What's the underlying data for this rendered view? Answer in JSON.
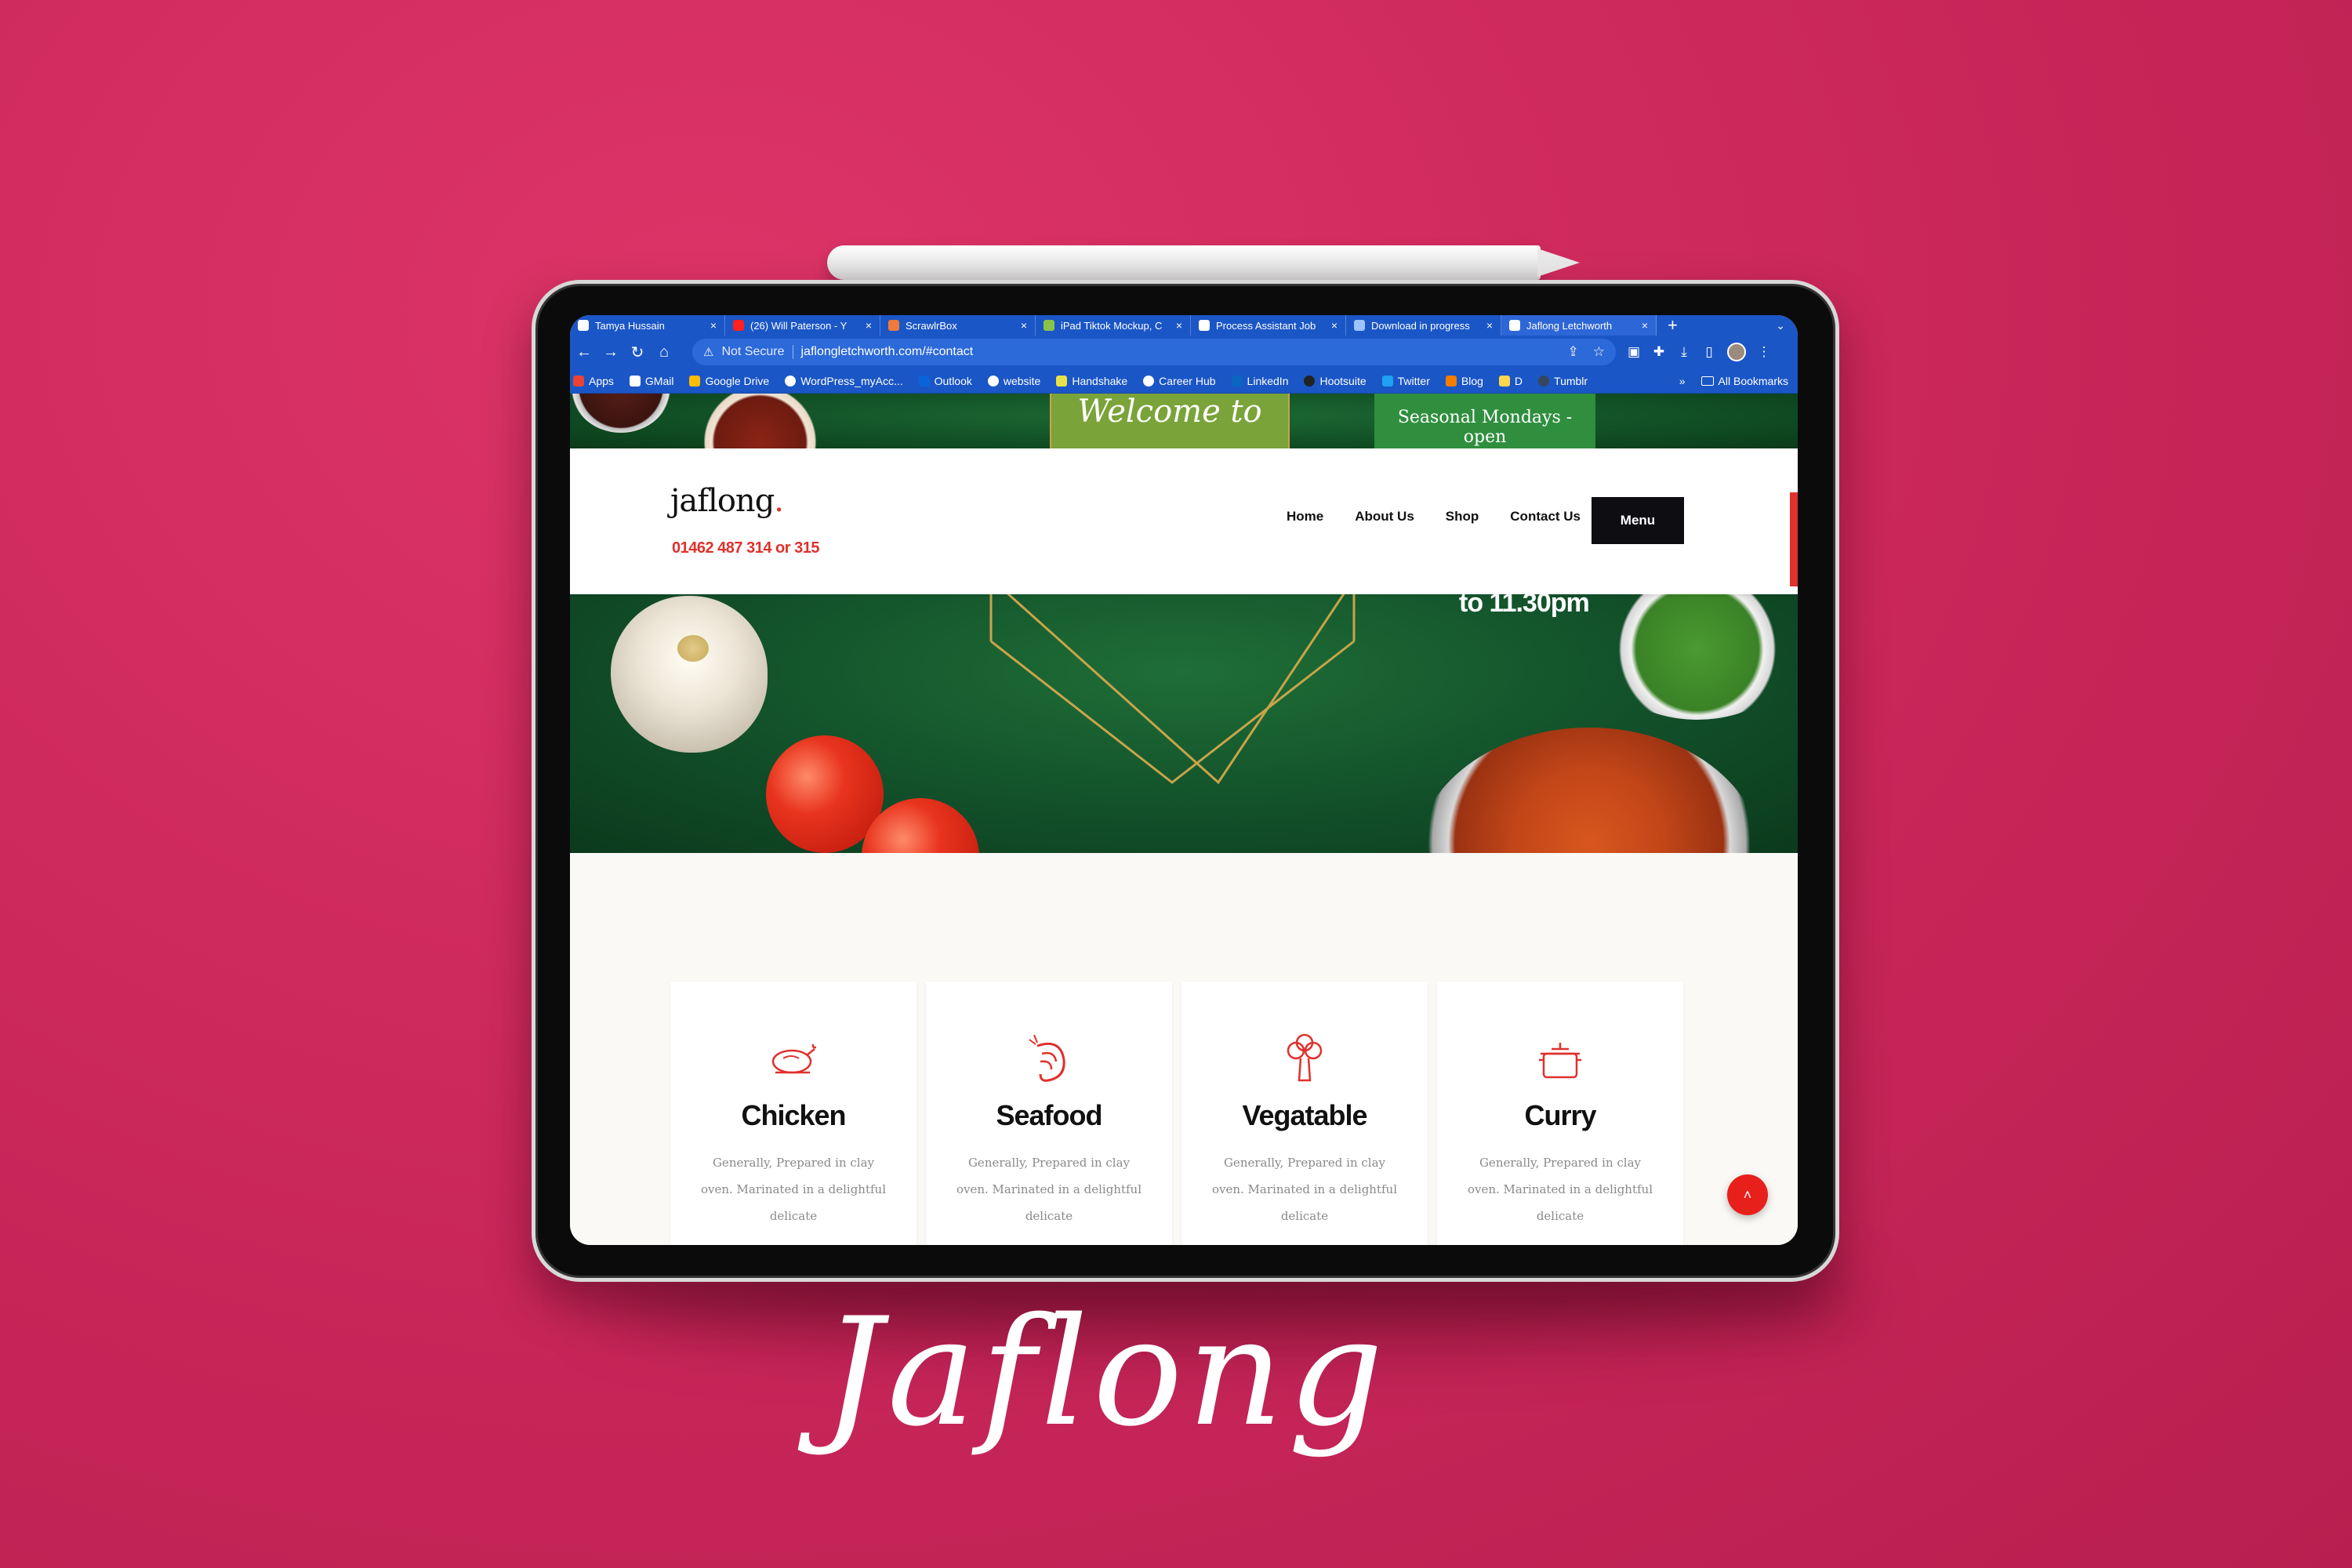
{
  "browser": {
    "tabs": [
      {
        "title": "Tamya Hussain",
        "active": false
      },
      {
        "title": "(26) Will Paterson - Y",
        "active": false
      },
      {
        "title": "ScrawlrBox",
        "active": false
      },
      {
        "title": "iPad Tiktok Mockup, C",
        "active": false
      },
      {
        "title": "Process Assistant Job",
        "active": false
      },
      {
        "title": "Download in progress",
        "active": false
      },
      {
        "title": "Jaflong Letchworth",
        "active": true
      }
    ],
    "new_tab": "+",
    "security_label": "Not Secure",
    "url": "jaflongletchworth.com/#contact",
    "bookmarks": [
      "Apps",
      "GMail",
      "Google Drive",
      "WordPress_myAcc...",
      "Outlook",
      "website",
      "Handshake",
      "Career Hub",
      "LinkedIn",
      "Hootsuite",
      "Twitter",
      "Blog",
      "D",
      "Tumblr"
    ],
    "more_bookmarks": "»",
    "all_bookmarks": "All Bookmarks"
  },
  "hero_top": {
    "welcome": "Welcome to",
    "seasonal": "Seasonal Mondays - open"
  },
  "header": {
    "logo": "jaflong",
    "logo_dot": ".",
    "phone": "01462 487 314 or 315",
    "nav": [
      "Home",
      "About Us",
      "Shop",
      "Contact Us"
    ],
    "menu_button": "Menu"
  },
  "hero": {
    "hours_text": "to 11.30pm"
  },
  "cards": [
    {
      "icon": "chicken-icon",
      "title": "Chicken",
      "desc": "Generally, Prepared in clay oven. Marinated in a delightful delicate"
    },
    {
      "icon": "shrimp-icon",
      "title": "Seafood",
      "desc": "Generally, Prepared in clay oven. Marinated in a delightful delicate"
    },
    {
      "icon": "broccoli-icon",
      "title": "Vegatable",
      "desc": "Generally, Prepared in clay oven. Marinated in a delightful delicate"
    },
    {
      "icon": "cooking-pot-icon",
      "title": "Curry",
      "desc": "Generally, Prepared in clay oven. Marinated in a delightful delicate"
    }
  ],
  "scroll_top_glyph": "˄",
  "caption": "Jaflong",
  "colors": {
    "background": "#cf2a5e",
    "browser_chrome": "#1a56c6",
    "accent_red": "#e0312c",
    "hero_green": "#12502a",
    "menu_button": "#0d0d12"
  }
}
